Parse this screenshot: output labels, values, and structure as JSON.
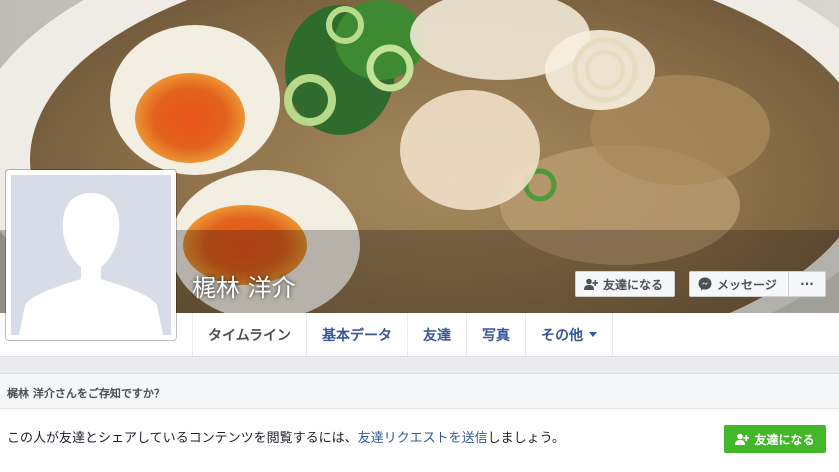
{
  "profile": {
    "name": "梶林 洋介"
  },
  "actions": {
    "add_friend_label": "友達になる",
    "message_label": "メッセージ",
    "more_label": "···"
  },
  "tabs": [
    {
      "label": "タイムライン",
      "active": true
    },
    {
      "label": "基本データ",
      "active": false
    },
    {
      "label": "友達",
      "active": false
    },
    {
      "label": "写真",
      "active": false
    },
    {
      "label": "その他",
      "active": false
    }
  ],
  "know_box": {
    "title": "梶林 洋介さんをご存知ですか？",
    "text_before": "この人が友達とシェアしているコンテンツを閲覧するには、",
    "link_text": "友達リクエストを送信",
    "text_after": "しましょう。",
    "button_label": "友達になる"
  },
  "colors": {
    "link": "#365899",
    "green": "#42b72a",
    "bg": "#e9ebee"
  },
  "icons": [
    "add-friend-icon",
    "messenger-icon",
    "silhouette-icon",
    "caret-down-icon"
  ]
}
